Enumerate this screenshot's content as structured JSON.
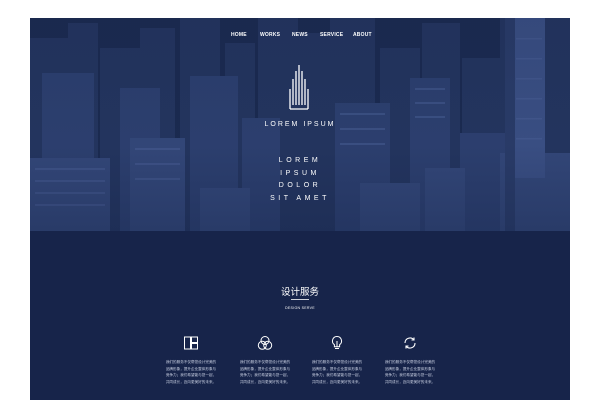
{
  "nav": {
    "items": [
      "HOME",
      "WORKS",
      "NEWS",
      "SERVICE",
      "ABOUT"
    ]
  },
  "logo": {
    "icon": "building-logo-icon",
    "text": "LOREM IPSUM"
  },
  "tagline": [
    "LOREM",
    "IPSUM",
    "DOLOR",
    "SIT AMET"
  ],
  "services": {
    "title": "设计服务",
    "subtitle": "DESIGN SERVE",
    "items": [
      {
        "icon": "layout-icon",
        "text": "我们的服务不仅帮您设计完美的品牌形象，提升企业整体形象与竞争力；我们希望能与您一起，共同成长，迈向更美好的未来。"
      },
      {
        "icon": "overlap-circles-icon",
        "text": "我们的服务不仅帮您设计完美的品牌形象，提升企业整体形象与竞争力；我们希望能与您一起，共同成长，迈向更美好的未来。"
      },
      {
        "icon": "lightbulb-icon",
        "text": "我们的服务不仅帮您设计完美的品牌形象，提升企业整体形象与竞争力；我们希望能与您一起，共同成长，迈向更美好的未来。"
      },
      {
        "icon": "refresh-icon",
        "text": "我们的服务不仅帮您设计完美的品牌形象，提升企业整体形象与竞争力；我们希望能与您一起，共同成长，迈向更美好的未来。"
      }
    ]
  },
  "colors": {
    "navy": "#17244a",
    "hero_tint": "#1d2c52",
    "text": "#ffffff",
    "muted": "#c9d0e2"
  }
}
